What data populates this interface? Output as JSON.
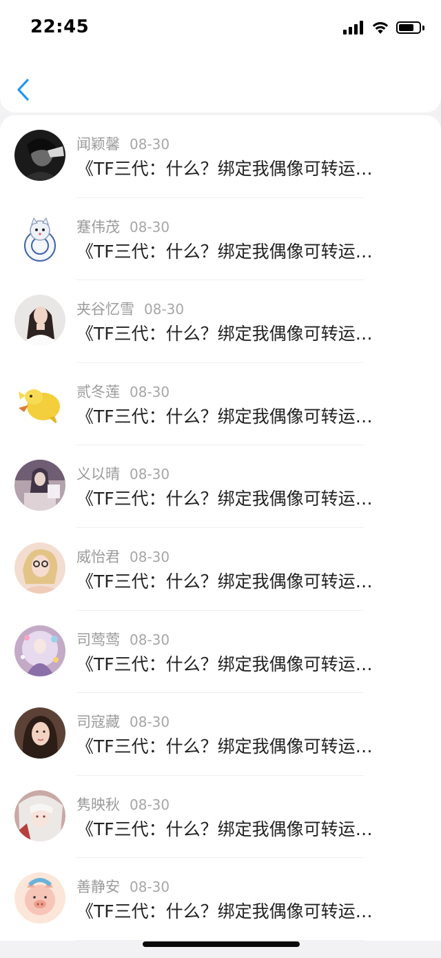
{
  "status_bar": {
    "time": "22:45",
    "battery_level": 0.75,
    "signal_bars": 4,
    "icons": [
      "signal-icon",
      "wifi-icon",
      "battery-icon"
    ]
  },
  "nav": {
    "back_icon": "chevron-left-icon",
    "accent_color": "#2196f3"
  },
  "items": [
    {
      "name": "闻颖馨",
      "date": "08-30",
      "message": "《TF三代：什么？绑定我偶像可转运…",
      "avatar": "dark-portrait"
    },
    {
      "name": "蹇伟茂",
      "date": "08-30",
      "message": "《TF三代：什么？绑定我偶像可转运…",
      "avatar": "porcelain-cat"
    },
    {
      "name": "夹谷忆雪",
      "date": "08-30",
      "message": "《TF三代：什么？绑定我偶像可转运…",
      "avatar": "girl-portrait"
    },
    {
      "name": "贰冬莲",
      "date": "08-30",
      "message": "《TF三代：什么？绑定我偶像可转运…",
      "avatar": "yellow-cartoon"
    },
    {
      "name": "义以晴",
      "date": "08-30",
      "message": "《TF三代：什么？绑定我偶像可转运…",
      "avatar": "purple-scene"
    },
    {
      "name": "威怡君",
      "date": "08-30",
      "message": "《TF三代：什么？绑定我偶像可转运…",
      "avatar": "blonde-portrait"
    },
    {
      "name": "司莺莺",
      "date": "08-30",
      "message": "《TF三代：什么？绑定我偶像可转运…",
      "avatar": "fantasy-art"
    },
    {
      "name": "司寇藏",
      "date": "08-30",
      "message": "《TF三代：什么？绑定我偶像可转运…",
      "avatar": "brunette-portrait"
    },
    {
      "name": "隽映秋",
      "date": "08-30",
      "message": "《TF三代：什么？绑定我偶像可转运…",
      "avatar": "anime-white-hair"
    },
    {
      "name": "善静安",
      "date": "08-30",
      "message": "《TF三代：什么？绑定我偶像可转运…",
      "avatar": "cartoon-pig"
    }
  ]
}
